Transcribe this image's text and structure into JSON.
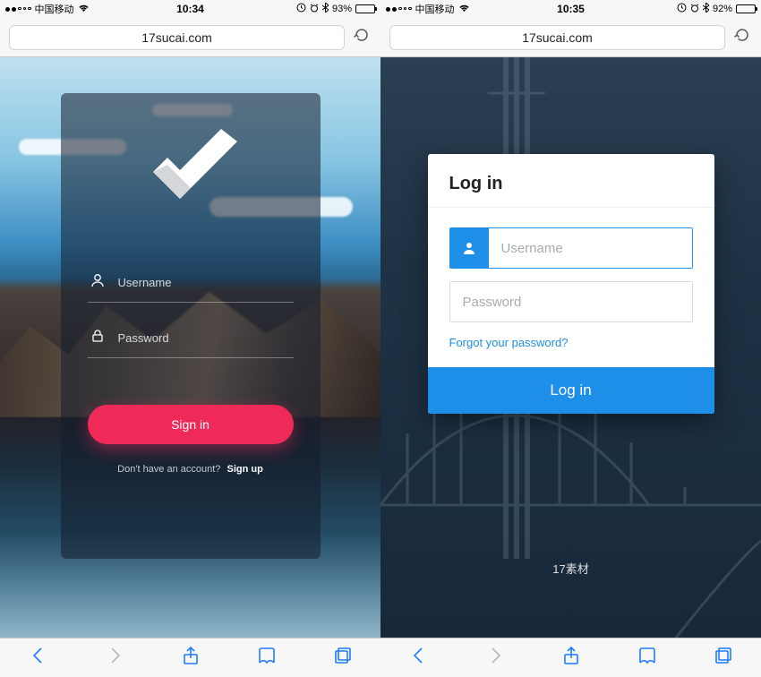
{
  "left": {
    "status": {
      "carrier": "中国移动",
      "time": "10:34",
      "battery_pct": "93%"
    },
    "address": "17sucai.com",
    "form": {
      "username_placeholder": "Username",
      "password_placeholder": "Password",
      "signin_label": "Sign in",
      "signup_prompt": "Don't have an account?",
      "signup_label": "Sign up"
    }
  },
  "right": {
    "status": {
      "carrier": "中国移动",
      "time": "10:35",
      "battery_pct": "92%"
    },
    "address": "17sucai.com",
    "form": {
      "title": "Log in",
      "username_placeholder": "Username",
      "password_placeholder": "Password",
      "forgot_label": "Forgot your password?",
      "login_label": "Log in"
    },
    "footer": "17素材"
  },
  "colors": {
    "accent_pink": "#ef2a58",
    "accent_blue": "#1e8fe8",
    "ios_blue": "#1e7cff"
  }
}
